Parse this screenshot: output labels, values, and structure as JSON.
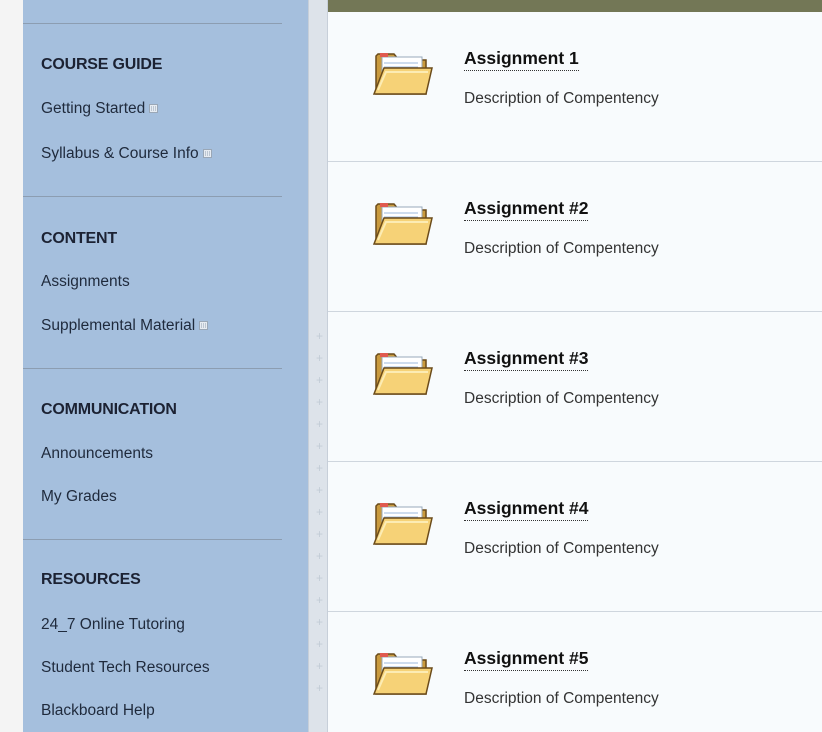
{
  "sidebar": {
    "sections": [
      {
        "heading": "COURSE GUIDE",
        "links": [
          {
            "label": "Getting Started",
            "external": true
          },
          {
            "label": "Syllabus & Course Info",
            "external": true
          }
        ]
      },
      {
        "heading": "CONTENT",
        "links": [
          {
            "label": "Assignments",
            "external": false
          },
          {
            "label": "Supplemental Material",
            "external": true
          }
        ]
      },
      {
        "heading": "COMMUNICATION",
        "links": [
          {
            "label": "Announcements",
            "external": false
          },
          {
            "label": "My Grades",
            "external": false
          }
        ]
      },
      {
        "heading": "RESOURCES",
        "links": [
          {
            "label": "24_7 Online Tutoring",
            "external": false
          },
          {
            "label": "Student Tech Resources",
            "external": false
          },
          {
            "label": "Blackboard Help",
            "external": false
          }
        ]
      }
    ]
  },
  "content": {
    "items": [
      {
        "title": "Assignment 1",
        "description": "Description of Compentency",
        "icon": "folder-icon"
      },
      {
        "title": "Assignment #2",
        "description": "Description of Compentency",
        "icon": "folder-icon"
      },
      {
        "title": "Assignment #3",
        "description": "Description of Compentency",
        "icon": "folder-icon"
      },
      {
        "title": "Assignment #4",
        "description": "Description of Compentency",
        "icon": "folder-icon"
      },
      {
        "title": "Assignment #5",
        "description": "Description of Compentency",
        "icon": "folder-icon"
      }
    ]
  },
  "colors": {
    "sidebar_bg": "#a5bfdd",
    "content_bg": "#f8fbfd",
    "top_bar": "#737756"
  }
}
